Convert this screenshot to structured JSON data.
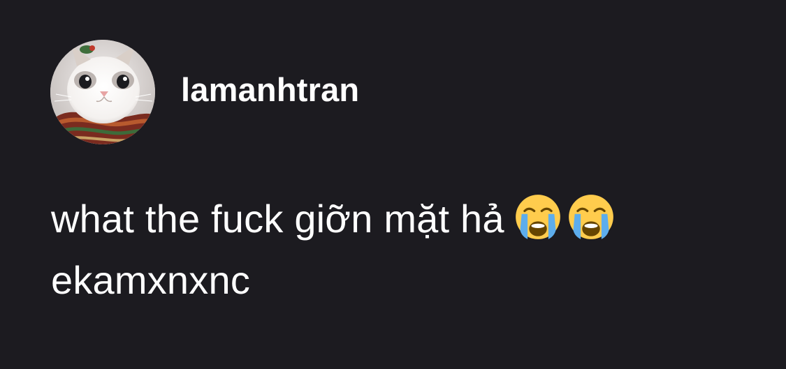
{
  "post": {
    "username": "lamanhtran",
    "text_line1": "what the fuck giỡn mặt hả",
    "text_line2": "ekamxnxnc",
    "emojis": [
      "loudly-crying-face-icon",
      "loudly-crying-face-icon"
    ]
  },
  "colors": {
    "background": "#1c1b20",
    "text": "#ffffff",
    "emoji_face": "#ffcc4d",
    "emoji_tears": "#5dadec"
  }
}
